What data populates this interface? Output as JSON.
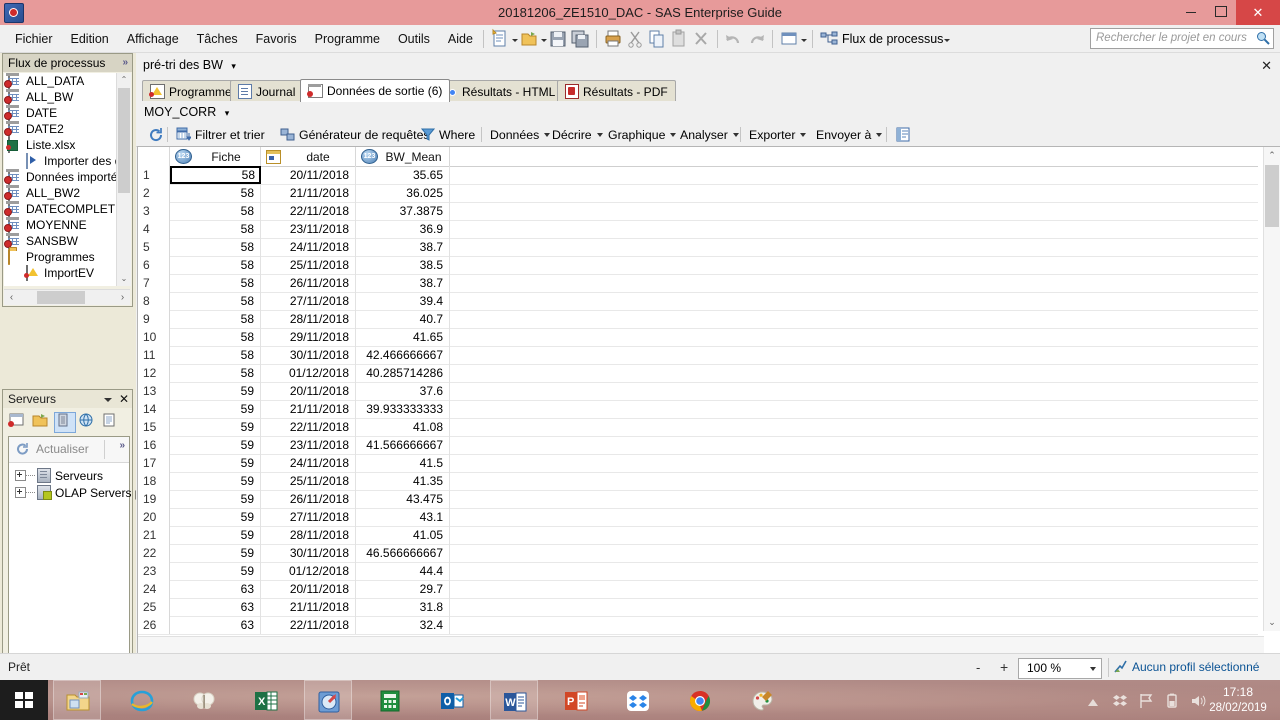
{
  "window": {
    "title": "20181206_ZE1510_DAC - SAS Enterprise Guide",
    "minimize": "–",
    "maximize": "❐",
    "close": "✕"
  },
  "menubar": {
    "items": [
      "Fichier",
      "Edition",
      "Affichage",
      "Tâches",
      "Favoris",
      "Programme",
      "Outils",
      "Aide"
    ],
    "toolbar_icons": [
      "new-document-icon",
      "open-folder-icon",
      "save-icon",
      "save-all-icon",
      "print-icon",
      "cut-icon",
      "copy-icon",
      "paste-icon",
      "delete-icon",
      "undo-icon",
      "redo-icon",
      "window-layout-icon"
    ],
    "flux_button": "Flux de processus"
  },
  "search": {
    "placeholder": "Rechercher le projet en cours",
    "icon": "search-icon"
  },
  "flux_panel": {
    "title": "Flux de processus",
    "overflow_chevron": "»",
    "items": [
      {
        "label": "ALL_DATA",
        "icon": "dataset-icon",
        "indent": 0
      },
      {
        "label": "ALL_BW",
        "icon": "dataset-icon",
        "indent": 0
      },
      {
        "label": "DATE",
        "icon": "dataset-icon",
        "indent": 0
      },
      {
        "label": "DATE2",
        "icon": "dataset-icon",
        "indent": 0
      },
      {
        "label": "Liste.xlsx",
        "icon": "excel-file-icon",
        "indent": 0
      },
      {
        "label": "Importer des do",
        "icon": "import-data-icon",
        "indent": 1
      },
      {
        "label": "Données importées",
        "icon": "dataset-icon",
        "indent": 0
      },
      {
        "label": "ALL_BW2",
        "icon": "dataset-icon",
        "indent": 0
      },
      {
        "label": "DATECOMPLETE",
        "icon": "dataset-icon",
        "indent": 0
      },
      {
        "label": "MOYENNE",
        "icon": "dataset-icon",
        "indent": 0
      },
      {
        "label": "SANSBW",
        "icon": "dataset-icon",
        "indent": 0
      },
      {
        "label": "Programmes",
        "icon": "folder-icon",
        "indent": 0
      },
      {
        "label": "ImportEV",
        "icon": "program-icon",
        "indent": 1
      }
    ],
    "scroll_up": "⌃",
    "scroll_down": "⌄",
    "scroll_left": "‹",
    "scroll_right": "›"
  },
  "servers_panel": {
    "title": "Serveurs",
    "menu_caret": "▾",
    "close": "✕",
    "toolbar_icons": [
      "server-list-icon",
      "folder-icon",
      "servers-icon",
      "web-icon",
      "library-icon"
    ],
    "refresh_label": "Actualiser",
    "refresh_icon": "refresh-icon",
    "overflow_chevron": "»",
    "nodes": [
      {
        "label": "Serveurs",
        "icon": "server-icon"
      },
      {
        "label": "OLAP Servers p",
        "icon": "olap-server-icon"
      }
    ],
    "scroll_left": "‹",
    "scroll_right": "›"
  },
  "document": {
    "breadcrumb": "pré-tri des BW",
    "breadcrumb_caret": "▾",
    "close_label": "✕",
    "tabs": [
      {
        "label": "Programme",
        "icon": "program-icon",
        "active": false
      },
      {
        "label": "Journal",
        "icon": "log-icon",
        "active": false
      },
      {
        "label": "Données de sortie (6)",
        "icon": "dataset-icon",
        "active": true
      },
      {
        "label": "Résultats - HTML",
        "icon": "chrome-icon",
        "active": false
      },
      {
        "label": "Résultats - PDF",
        "icon": "pdf-icon",
        "active": false
      }
    ],
    "dataset_name": "MOY_CORR",
    "dataset_caret": "▾",
    "toolbar": [
      {
        "label": "",
        "icon": "refresh-icon",
        "caret": false
      },
      {
        "label": "Filtrer et trier",
        "icon": "filter-sort-icon",
        "caret": false
      },
      {
        "label": "Générateur de requêtes",
        "icon": "query-builder-icon",
        "caret": false
      },
      {
        "label": "Where",
        "icon": "where-filter-icon",
        "caret": false
      },
      {
        "label": "Données",
        "icon": "",
        "caret": true
      },
      {
        "label": "Décrire",
        "icon": "",
        "caret": true
      },
      {
        "label": "Graphique",
        "icon": "",
        "caret": true
      },
      {
        "label": "Analyser",
        "icon": "",
        "caret": true
      },
      {
        "label": "Exporter",
        "icon": "",
        "caret": true
      },
      {
        "label": "Envoyer à",
        "icon": "",
        "caret": true
      },
      {
        "label": "",
        "icon": "properties-icon",
        "caret": false
      }
    ]
  },
  "grid": {
    "columns": [
      {
        "label": "Fiche",
        "icon": "numeric-column-icon"
      },
      {
        "label": "date",
        "icon": "date-column-icon"
      },
      {
        "label": "BW_Mean",
        "icon": "numeric-column-icon"
      }
    ],
    "selected_cell": {
      "row": 1,
      "column": "Fiche"
    },
    "rows": [
      {
        "n": "1",
        "Fiche": "58",
        "date": "20/11/2018",
        "BW_Mean": "35.65"
      },
      {
        "n": "2",
        "Fiche": "58",
        "date": "21/11/2018",
        "BW_Mean": "36.025"
      },
      {
        "n": "3",
        "Fiche": "58",
        "date": "22/11/2018",
        "BW_Mean": "37.3875"
      },
      {
        "n": "4",
        "Fiche": "58",
        "date": "23/11/2018",
        "BW_Mean": "36.9"
      },
      {
        "n": "5",
        "Fiche": "58",
        "date": "24/11/2018",
        "BW_Mean": "38.7"
      },
      {
        "n": "6",
        "Fiche": "58",
        "date": "25/11/2018",
        "BW_Mean": "38.5"
      },
      {
        "n": "7",
        "Fiche": "58",
        "date": "26/11/2018",
        "BW_Mean": "38.7"
      },
      {
        "n": "8",
        "Fiche": "58",
        "date": "27/11/2018",
        "BW_Mean": "39.4"
      },
      {
        "n": "9",
        "Fiche": "58",
        "date": "28/11/2018",
        "BW_Mean": "40.7"
      },
      {
        "n": "10",
        "Fiche": "58",
        "date": "29/11/2018",
        "BW_Mean": "41.65"
      },
      {
        "n": "11",
        "Fiche": "58",
        "date": "30/11/2018",
        "BW_Mean": "42.466666667"
      },
      {
        "n": "12",
        "Fiche": "58",
        "date": "01/12/2018",
        "BW_Mean": "40.285714286"
      },
      {
        "n": "13",
        "Fiche": "59",
        "date": "20/11/2018",
        "BW_Mean": "37.6"
      },
      {
        "n": "14",
        "Fiche": "59",
        "date": "21/11/2018",
        "BW_Mean": "39.933333333"
      },
      {
        "n": "15",
        "Fiche": "59",
        "date": "22/11/2018",
        "BW_Mean": "41.08"
      },
      {
        "n": "16",
        "Fiche": "59",
        "date": "23/11/2018",
        "BW_Mean": "41.566666667"
      },
      {
        "n": "17",
        "Fiche": "59",
        "date": "24/11/2018",
        "BW_Mean": "41.5"
      },
      {
        "n": "18",
        "Fiche": "59",
        "date": "25/11/2018",
        "BW_Mean": "41.35"
      },
      {
        "n": "19",
        "Fiche": "59",
        "date": "26/11/2018",
        "BW_Mean": "43.475"
      },
      {
        "n": "20",
        "Fiche": "59",
        "date": "27/11/2018",
        "BW_Mean": "43.1"
      },
      {
        "n": "21",
        "Fiche": "59",
        "date": "28/11/2018",
        "BW_Mean": "41.05"
      },
      {
        "n": "22",
        "Fiche": "59",
        "date": "30/11/2018",
        "BW_Mean": "46.566666667"
      },
      {
        "n": "23",
        "Fiche": "59",
        "date": "01/12/2018",
        "BW_Mean": "44.4"
      },
      {
        "n": "24",
        "Fiche": "63",
        "date": "20/11/2018",
        "BW_Mean": "29.7"
      },
      {
        "n": "25",
        "Fiche": "63",
        "date": "21/11/2018",
        "BW_Mean": "31.8"
      },
      {
        "n": "26",
        "Fiche": "63",
        "date": "22/11/2018",
        "BW_Mean": "32.4"
      }
    ],
    "scroll_up": "⌃",
    "scroll_down": "⌄"
  },
  "statusbar": {
    "status": "Prêt",
    "zoom_minus": "-",
    "zoom_plus": "+",
    "zoom_value": "100 %",
    "zoom_caret": "▾",
    "profile_text": "Aucun profil sélectionné",
    "profile_icon": "profile-icon"
  },
  "taskbar": {
    "start_icon": "windows-start-icon",
    "apps": [
      {
        "name": "file-explorer-icon",
        "pinned": true
      },
      {
        "name": "internet-explorer-icon",
        "pinned": false
      },
      {
        "name": "butterfly-icon",
        "pinned": false
      },
      {
        "name": "excel-icon",
        "pinned": false
      },
      {
        "name": "sas-enterprise-guide-icon",
        "pinned": true
      },
      {
        "name": "calculator-icon",
        "pinned": false
      },
      {
        "name": "outlook-icon",
        "pinned": false
      },
      {
        "name": "word-icon",
        "pinned": true
      },
      {
        "name": "powerpoint-icon",
        "pinned": false
      },
      {
        "name": "dropbox-icon",
        "pinned": false
      },
      {
        "name": "chrome-icon",
        "pinned": false
      },
      {
        "name": "paint-icon",
        "pinned": false
      }
    ],
    "tray_icons": [
      "show-hidden-icons-arrow",
      "dropbox-tray-icon",
      "flag-action-center-icon",
      "battery-icon",
      "volume-icon"
    ],
    "time": "17:18",
    "date": "28/02/2019"
  },
  "colors": {
    "titlebar": "#e79a9a",
    "close_button": "#d64747",
    "accent_blue": "#0b5394",
    "taskbar": "#a9807c"
  }
}
